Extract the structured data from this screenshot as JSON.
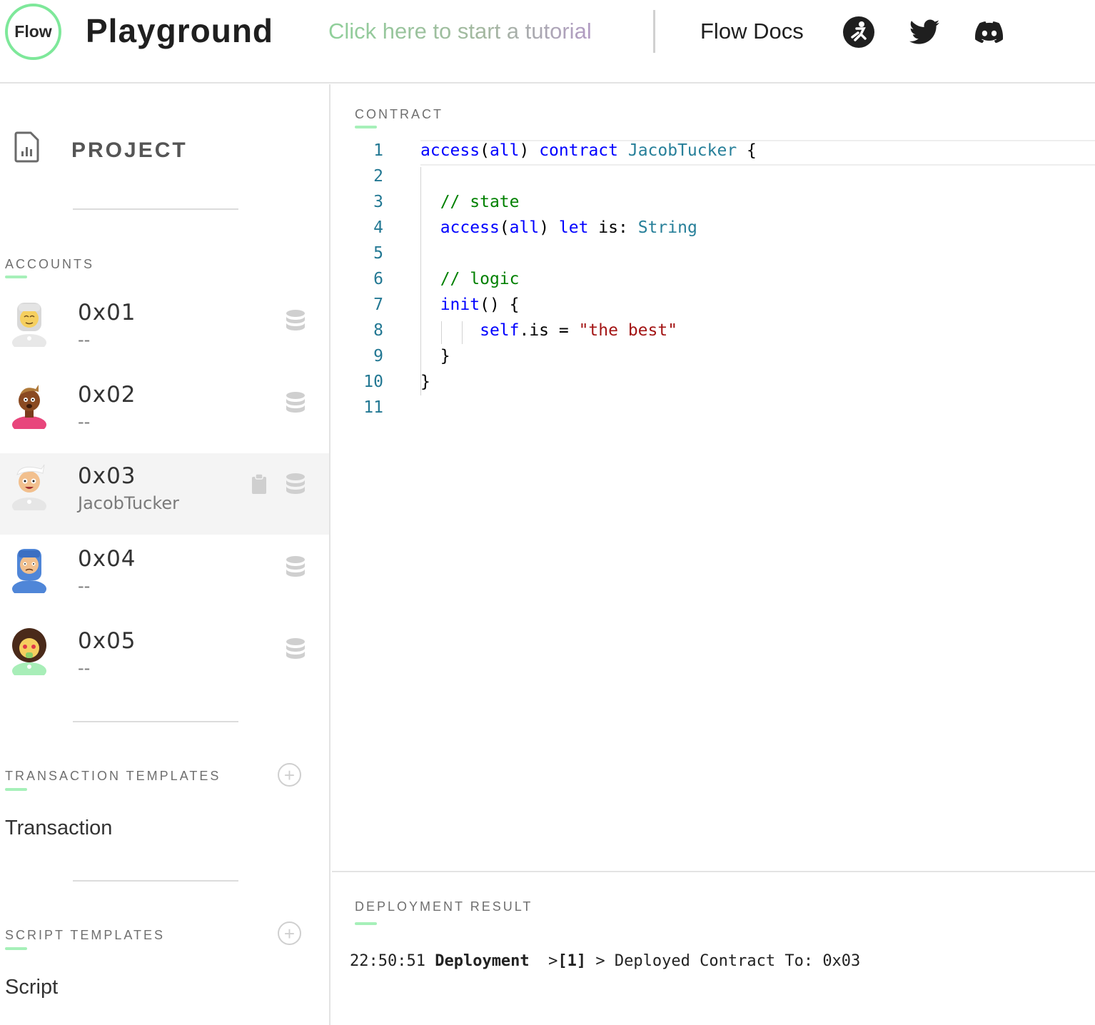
{
  "header": {
    "logo_text": "Flow",
    "title": "Playground",
    "tutorial_link": "Click here to start a tutorial",
    "docs_link": "Flow Docs",
    "social_icons": [
      "community-icon",
      "twitter-icon",
      "discord-icon"
    ]
  },
  "sidebar": {
    "project_label": "PROJECT",
    "accounts_title": "ACCOUNTS",
    "accounts": [
      {
        "address": "0x01",
        "contract": "--",
        "selected": false
      },
      {
        "address": "0x02",
        "contract": "--",
        "selected": false
      },
      {
        "address": "0x03",
        "contract": "JacobTucker",
        "selected": true
      },
      {
        "address": "0x04",
        "contract": "--",
        "selected": false
      },
      {
        "address": "0x05",
        "contract": "--",
        "selected": false
      }
    ],
    "transaction_templates_title": "TRANSACTION TEMPLATES",
    "transaction_templates": [
      "Transaction"
    ],
    "script_templates_title": "SCRIPT TEMPLATES",
    "script_templates": [
      "Script"
    ]
  },
  "editor": {
    "panel_title": "CONTRACT",
    "line_numbers": [
      "1",
      "2",
      "3",
      "4",
      "5",
      "6",
      "7",
      "8",
      "9",
      "10",
      "11"
    ],
    "lines": [
      {
        "tokens": [
          [
            "kw",
            "access"
          ],
          [
            "",
            "("
          ],
          [
            "kw",
            "all"
          ],
          [
            "",
            ") "
          ],
          [
            "kw",
            "contract"
          ],
          [
            "",
            " "
          ],
          [
            "ty",
            "JacobTucker"
          ],
          [
            "",
            " {"
          ]
        ]
      },
      {
        "tokens": []
      },
      {
        "tokens": [
          [
            "",
            "  "
          ],
          [
            "cm",
            "// state"
          ]
        ]
      },
      {
        "tokens": [
          [
            "",
            "  "
          ],
          [
            "kw",
            "access"
          ],
          [
            "",
            "("
          ],
          [
            "kw",
            "all"
          ],
          [
            "",
            ") "
          ],
          [
            "kw",
            "let"
          ],
          [
            "",
            " is: "
          ],
          [
            "ty",
            "String"
          ]
        ]
      },
      {
        "tokens": []
      },
      {
        "tokens": [
          [
            "",
            "  "
          ],
          [
            "cm",
            "// logic"
          ]
        ]
      },
      {
        "tokens": [
          [
            "",
            "  "
          ],
          [
            "kw",
            "init"
          ],
          [
            "",
            "() {"
          ]
        ]
      },
      {
        "tokens": [
          [
            "",
            "      "
          ],
          [
            "kw",
            "self"
          ],
          [
            "",
            ".is = "
          ],
          [
            "str",
            "\"the best\""
          ]
        ]
      },
      {
        "tokens": [
          [
            "",
            "  }"
          ]
        ]
      },
      {
        "tokens": [
          [
            "",
            "}"
          ]
        ]
      },
      {
        "tokens": []
      }
    ]
  },
  "deployment": {
    "panel_title": "DEPLOYMENT RESULT",
    "time": "22:50:51",
    "label": "Deployment",
    "index": "[1]",
    "message": "Deployed Contract To: 0x03"
  },
  "colors": {
    "accent_green": "#a6f0b9",
    "logo_ring": "#7ee89a",
    "keyword": "#0000ff",
    "comment": "#008000",
    "type": "#267f99",
    "string": "#a31515"
  }
}
